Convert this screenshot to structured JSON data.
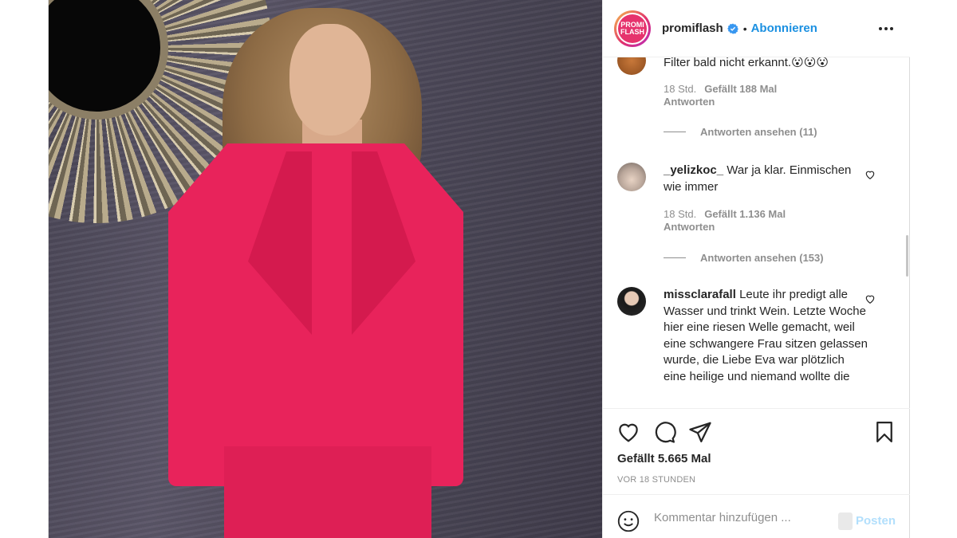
{
  "header": {
    "logo_text_1": "PROMI",
    "logo_text_2": "FLASH",
    "username": "promiflash",
    "separator": "•",
    "follow_label": "Abonnieren"
  },
  "comments": [
    {
      "username": "",
      "text": "Filter bald nicht erkannt.",
      "emoji": "😮😮😮",
      "time": "18 Std.",
      "likes": "Gefällt 188 Mal",
      "reply_label": "Antworten",
      "view_replies": "Antworten ansehen (11)"
    },
    {
      "username": "_yelizkoc_",
      "text": "War ja klar. Einmischen wie immer",
      "time": "18 Std.",
      "likes": "Gefällt 1.136 Mal",
      "reply_label": "Antworten",
      "view_replies": "Antworten ansehen (153)"
    },
    {
      "username": "missclarafall",
      "text": "Leute ihr predigt alle Wasser und trinkt Wein. Letzte Woche hier eine riesen Welle gemacht, weil eine schwangere Frau sitzen gelassen wurde, die Liebe Eva war plötzlich eine heilige und niemand wollte die"
    }
  ],
  "actions": {
    "likes": "Gefällt 5.665 Mal",
    "posted_time": "VOR 18 STUNDEN"
  },
  "add_comment": {
    "placeholder": "Kommentar hinzufügen ...",
    "post_label": "Posten"
  },
  "icons": {
    "verified": "verified-badge-icon",
    "more": "more-options-icon",
    "like": "heart-icon",
    "comment": "comment-bubble-icon",
    "share": "paper-plane-icon",
    "save": "bookmark-icon",
    "emoji": "smiley-icon"
  },
  "colors": {
    "accent": "#1b90e1",
    "post_disabled": "#b2dffc",
    "muted": "#8e8e8e",
    "jacket": "#e8235b"
  }
}
